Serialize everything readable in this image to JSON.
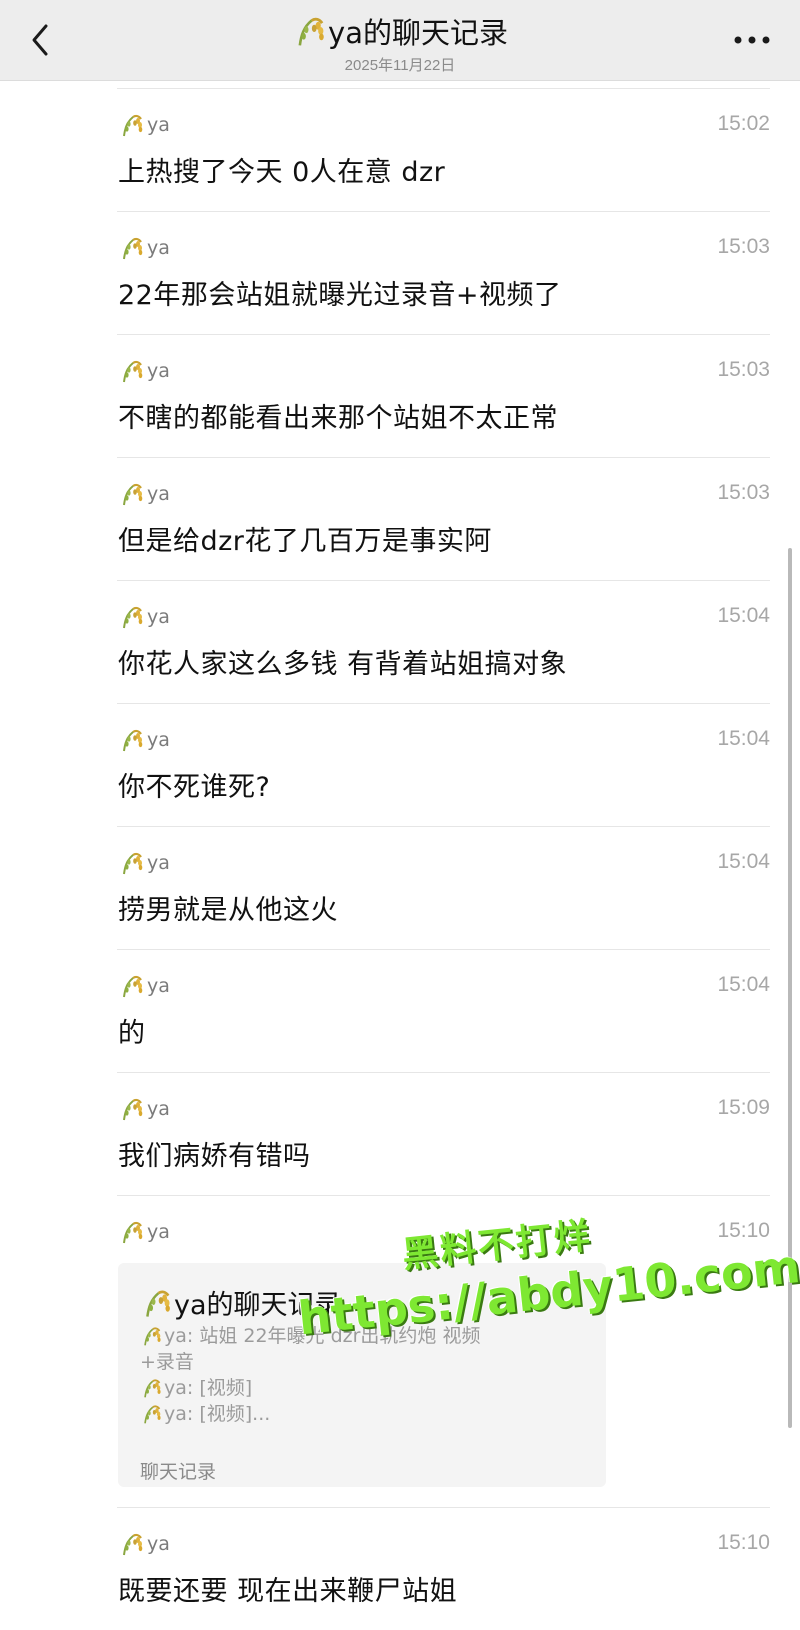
{
  "header": {
    "title": "ya的聊天记录",
    "date": "2025年11月22日"
  },
  "messages": [
    {
      "sender": "ya",
      "time": "15:02",
      "text": "上热搜了今天 0人在意 dzr"
    },
    {
      "sender": "ya",
      "time": "15:03",
      "text": "22年那会站姐就曝光过录音+视频了"
    },
    {
      "sender": "ya",
      "time": "15:03",
      "text": "不瞎的都能看出来那个站姐不太正常"
    },
    {
      "sender": "ya",
      "time": "15:03",
      "text": "但是给dzr花了几百万是事实阿"
    },
    {
      "sender": "ya",
      "time": "15:04",
      "text": "你花人家这么多钱 有背着站姐搞对象"
    },
    {
      "sender": "ya",
      "time": "15:04",
      "text": "你不死谁死?"
    },
    {
      "sender": "ya",
      "time": "15:04",
      "text": "捞男就是从他这火"
    },
    {
      "sender": "ya",
      "time": "15:04",
      "text": "的"
    },
    {
      "sender": "ya",
      "time": "15:09",
      "text": "我们病娇有错吗"
    }
  ],
  "record_message": {
    "sender": "ya",
    "time": "15:10",
    "card": {
      "title": "ya的聊天记录",
      "line1": "ya: 站姐 22年曝光 dzr出轨约炮 视频",
      "line1b": "+录音",
      "line2": "ya: [视频]",
      "line3": "ya: [视频]...",
      "footer": "聊天记录"
    }
  },
  "last_message": {
    "sender": "ya",
    "time": "15:10",
    "text": "既要还要 现在出来鞭尸站姐"
  },
  "watermark": {
    "line1": "黑料不打烊",
    "line2": "https://abdy10.com"
  },
  "colors": {
    "header_bg": "#ededed",
    "watermark": "#7ee832"
  },
  "icons": [
    "back-icon",
    "more-icon",
    "rice-icon"
  ]
}
